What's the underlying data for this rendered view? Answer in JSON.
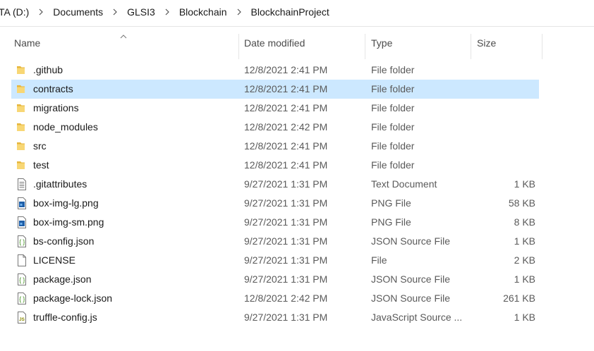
{
  "breadcrumb": {
    "items": [
      "TA (D:)",
      "Documents",
      "GLSI3",
      "Blockchain",
      "BlockchainProject"
    ]
  },
  "columns": {
    "name": "Name",
    "date": "Date modified",
    "type": "Type",
    "size": "Size"
  },
  "sort": {
    "column": "name",
    "direction": "ascending"
  },
  "files": [
    {
      "name": ".github",
      "date": "12/8/2021 2:41 PM",
      "type": "File folder",
      "size": "",
      "icon": "folder-icon",
      "selected": false
    },
    {
      "name": "contracts",
      "date": "12/8/2021 2:41 PM",
      "type": "File folder",
      "size": "",
      "icon": "folder-icon",
      "selected": true
    },
    {
      "name": "migrations",
      "date": "12/8/2021 2:41 PM",
      "type": "File folder",
      "size": "",
      "icon": "folder-icon",
      "selected": false
    },
    {
      "name": "node_modules",
      "date": "12/8/2021 2:42 PM",
      "type": "File folder",
      "size": "",
      "icon": "folder-icon",
      "selected": false
    },
    {
      "name": "src",
      "date": "12/8/2021 2:41 PM",
      "type": "File folder",
      "size": "",
      "icon": "folder-icon",
      "selected": false
    },
    {
      "name": "test",
      "date": "12/8/2021 2:41 PM",
      "type": "File folder",
      "size": "",
      "icon": "folder-icon",
      "selected": false
    },
    {
      "name": ".gitattributes",
      "date": "9/27/2021 1:31 PM",
      "type": "Text Document",
      "size": "1 KB",
      "icon": "text-document-icon",
      "selected": false
    },
    {
      "name": "box-img-lg.png",
      "date": "9/27/2021 1:31 PM",
      "type": "PNG File",
      "size": "58 KB",
      "icon": "image-file-icon",
      "selected": false
    },
    {
      "name": "box-img-sm.png",
      "date": "9/27/2021 1:31 PM",
      "type": "PNG File",
      "size": "8 KB",
      "icon": "image-file-icon",
      "selected": false
    },
    {
      "name": "bs-config.json",
      "date": "9/27/2021 1:31 PM",
      "type": "JSON Source File",
      "size": "1 KB",
      "icon": "json-file-icon",
      "selected": false
    },
    {
      "name": "LICENSE",
      "date": "9/27/2021 1:31 PM",
      "type": "File",
      "size": "2 KB",
      "icon": "blank-file-icon",
      "selected": false
    },
    {
      "name": "package.json",
      "date": "9/27/2021 1:31 PM",
      "type": "JSON Source File",
      "size": "1 KB",
      "icon": "json-file-icon",
      "selected": false
    },
    {
      "name": "package-lock.json",
      "date": "12/8/2021 2:42 PM",
      "type": "JSON Source File",
      "size": "261 KB",
      "icon": "json-file-icon",
      "selected": false
    },
    {
      "name": "truffle-config.js",
      "date": "9/27/2021 1:31 PM",
      "type": "JavaScript Source ...",
      "size": "1 KB",
      "icon": "javascript-file-icon",
      "selected": false
    }
  ],
  "colors": {
    "selection": "#cce8ff",
    "folder": "#f8d775",
    "folder_dark": "#e6b63c",
    "text": "#1a1a1a",
    "muted": "#5a5a5a"
  }
}
